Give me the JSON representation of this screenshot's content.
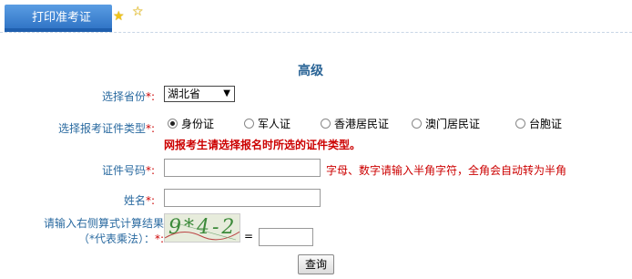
{
  "tab": {
    "label": "打印准考证"
  },
  "form": {
    "title": "高级",
    "province": {
      "label": "选择省份",
      "required_mark": "*:",
      "selected": "湖北省"
    },
    "id_type": {
      "label": "选择报考证件类型",
      "required_mark": "*:",
      "options": [
        "身份证",
        "军人证",
        "香港居民证",
        "澳门居民证",
        "台胞证"
      ],
      "selected": "身份证",
      "warning": "网报考生请选择报名时所选的证件类型。"
    },
    "id_number": {
      "label": "证件号码",
      "required_mark": "*:",
      "value": "",
      "hint": "字母、数字请输入半角字符，全角会自动转为半角"
    },
    "name": {
      "label": "姓名",
      "required_mark": "*:",
      "value": ""
    },
    "captcha": {
      "label_line1": "请输入右侧算式计算结果",
      "label_line2": "（*代表乘法）：",
      "required_mark": "*:",
      "expression": "9*4-2",
      "equals": "=",
      "value": ""
    },
    "submit_label": "查询"
  }
}
